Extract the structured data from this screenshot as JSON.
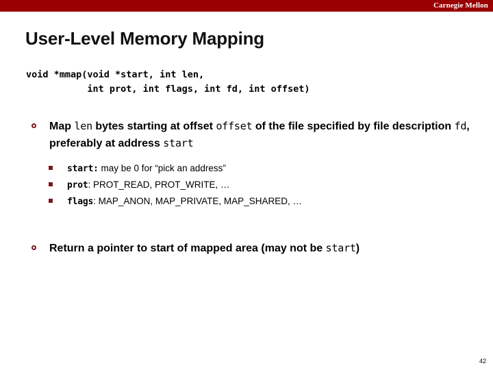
{
  "theme": {
    "banner_color": "#990000",
    "marker_color": "#7B1520",
    "text_color": "#000000",
    "background": "#ffffff"
  },
  "header": {
    "brand": "Carnegie Mellon"
  },
  "title": "User-Level Memory Mapping",
  "code_signature": {
    "line1": "void *mmap(void *start, int len,",
    "line2": "           int prot, int flags, int fd, int offset)"
  },
  "bullets": [
    {
      "marker": "circle-marker",
      "segments": [
        {
          "kind": "text",
          "value": "Map "
        },
        {
          "kind": "code",
          "value": "len"
        },
        {
          "kind": "text",
          "value": " bytes starting at offset "
        },
        {
          "kind": "code",
          "value": "offset"
        },
        {
          "kind": "text",
          "value": "  of the file specified by file description "
        },
        {
          "kind": "code",
          "value": "fd"
        },
        {
          "kind": "text",
          "value": ", preferably at address "
        },
        {
          "kind": "code",
          "value": "start"
        }
      ],
      "sub_bullets": [
        {
          "marker": "square-marker",
          "code": "start:",
          "text": " may be 0 for “pick an address”"
        },
        {
          "marker": "square-marker",
          "code": "prot",
          "text": ": PROT_READ, PROT_WRITE, …"
        },
        {
          "marker": "square-marker",
          "code": "flags",
          "text": ": MAP_ANON, MAP_PRIVATE, MAP_SHARED, …"
        }
      ]
    },
    {
      "marker": "circle-marker",
      "segments": [
        {
          "kind": "text",
          "value": "Return a pointer to start of mapped area (may not be "
        },
        {
          "kind": "code",
          "value": "start"
        },
        {
          "kind": "text",
          "value": ")"
        }
      ],
      "sub_bullets": []
    }
  ],
  "footer": {
    "page_number": "42"
  }
}
